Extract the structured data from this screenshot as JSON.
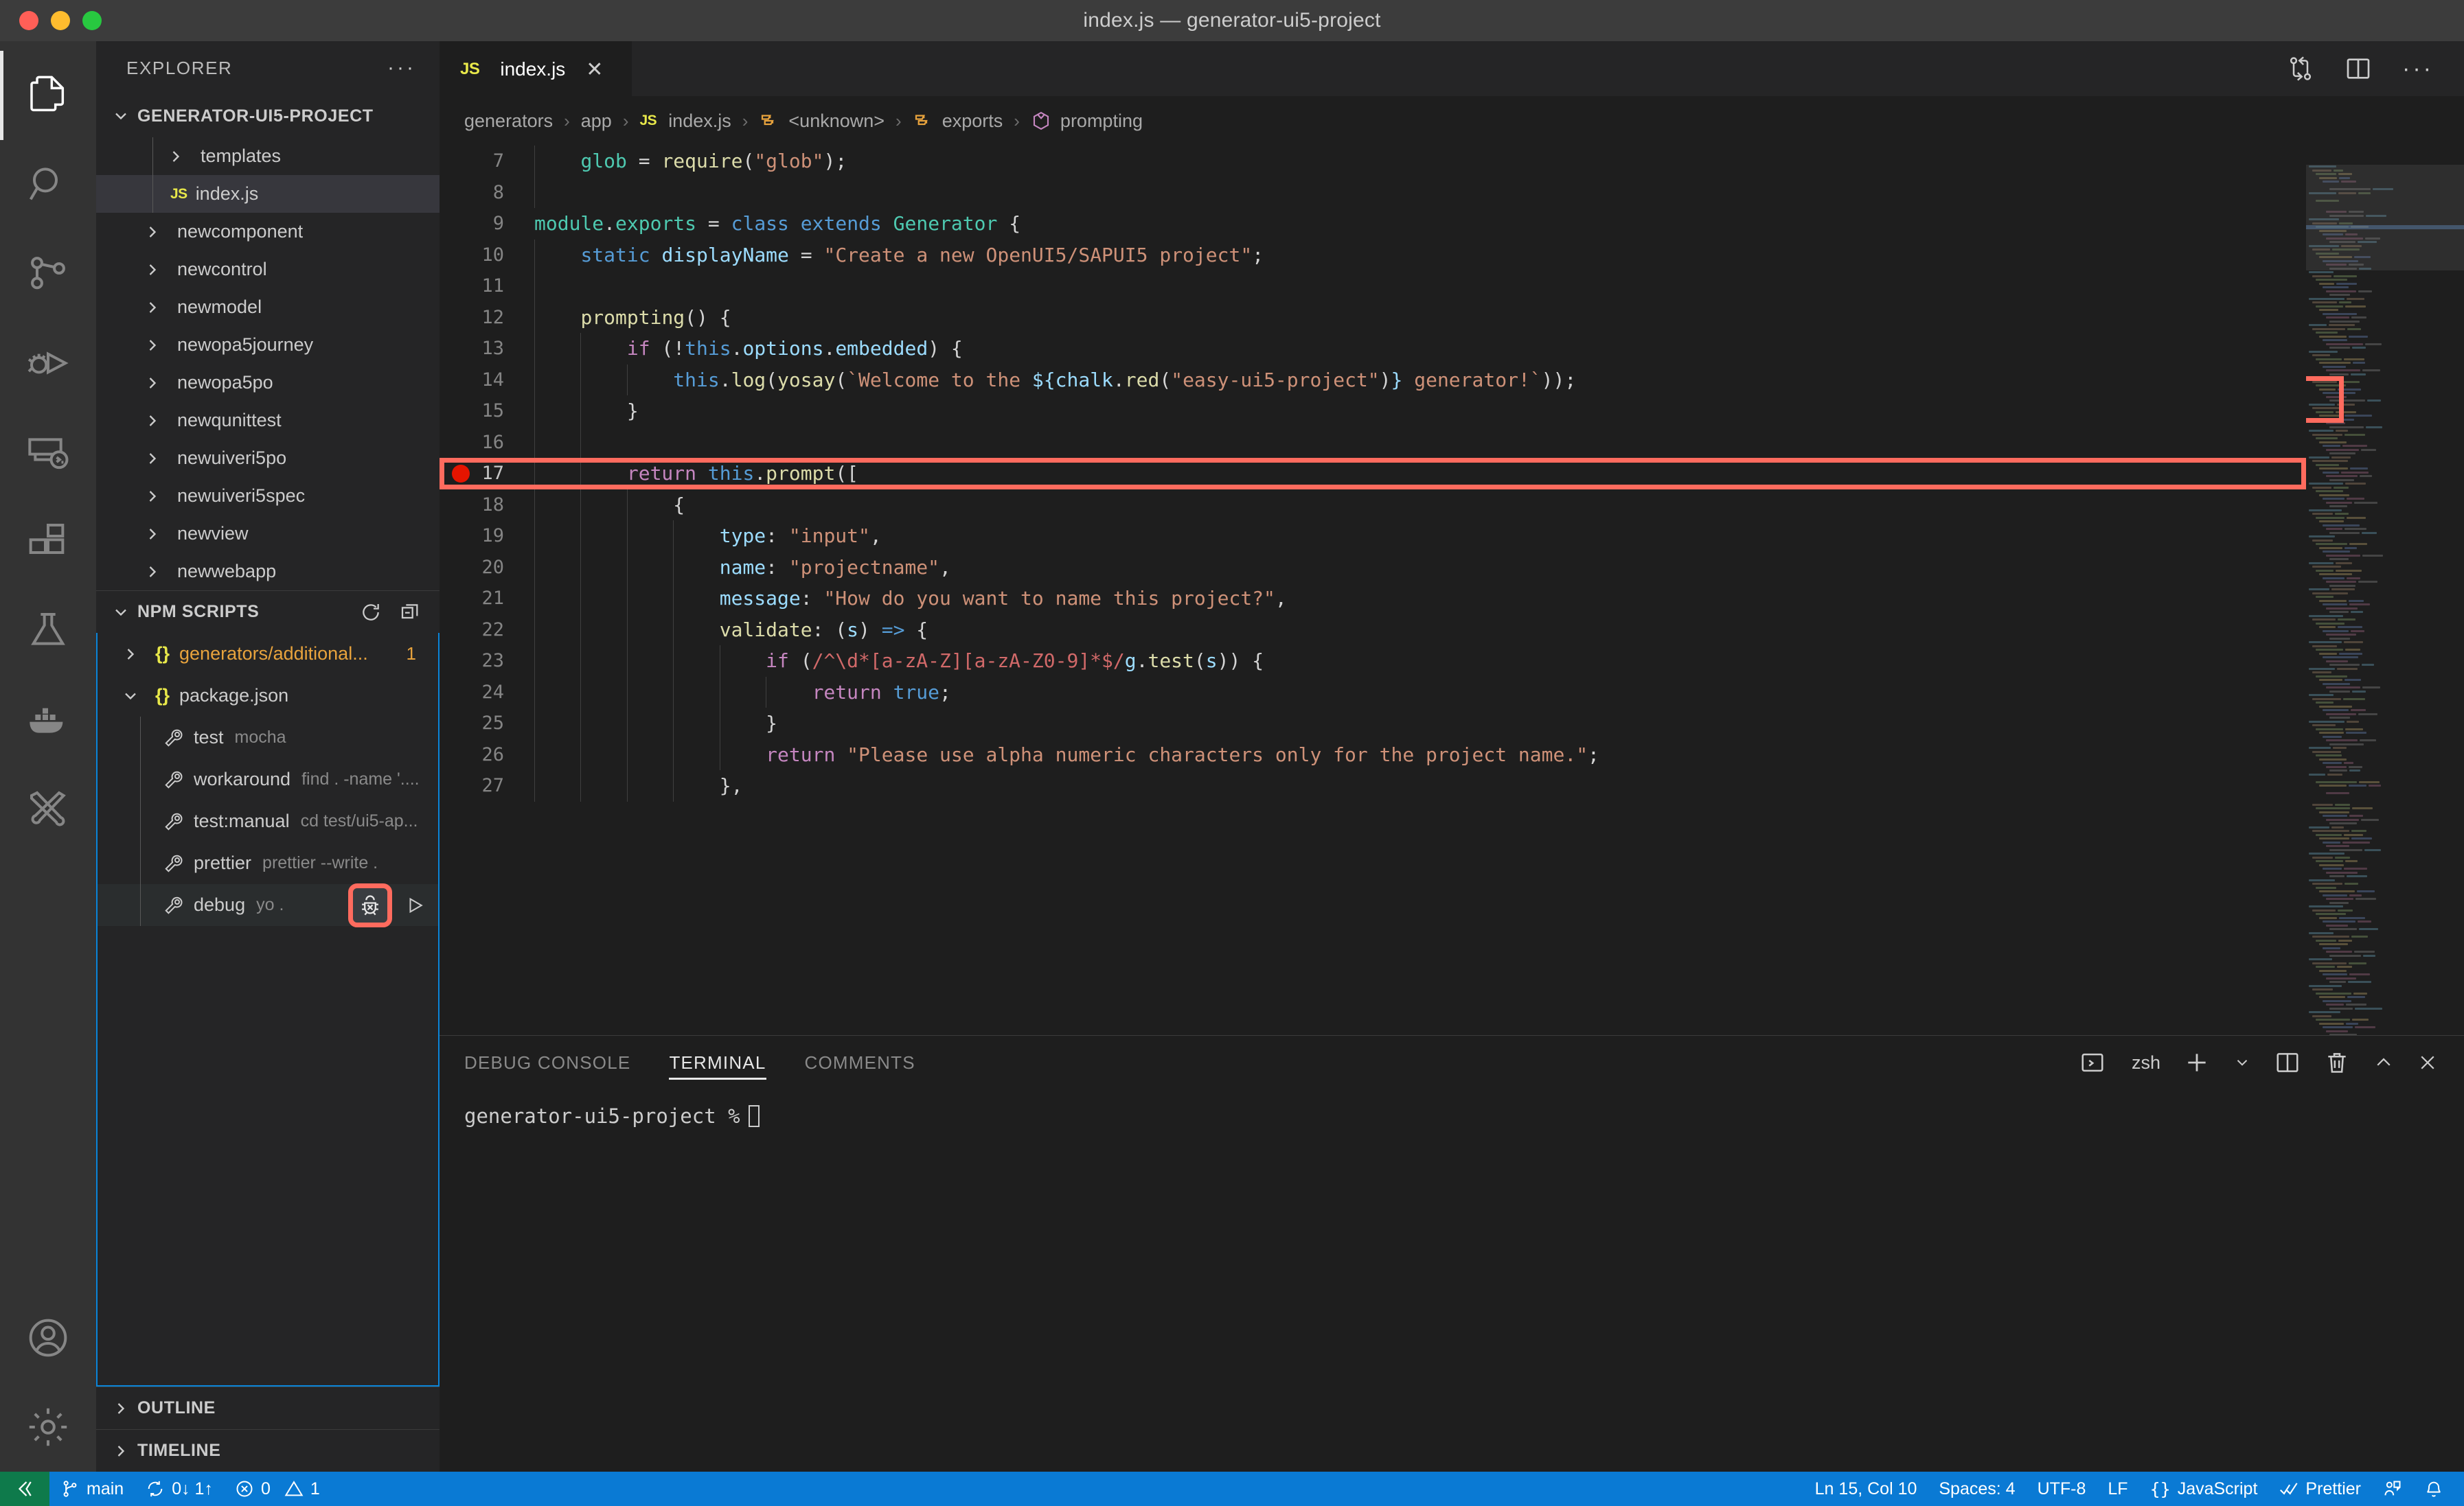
{
  "window": {
    "title": "index.js — generator-ui5-project",
    "traffic_lights": [
      "close-red",
      "minimize-yellow",
      "zoom-green"
    ]
  },
  "activitybar": {
    "items": [
      {
        "name": "explorer",
        "icon": "files-icon",
        "active": true
      },
      {
        "name": "search",
        "icon": "search-icon",
        "active": false
      },
      {
        "name": "source-control",
        "icon": "source-control-icon",
        "active": false
      },
      {
        "name": "run-and-debug",
        "icon": "run-debug-icon",
        "active": false
      },
      {
        "name": "remote-explorer",
        "icon": "remote-explorer-icon",
        "active": false
      },
      {
        "name": "extensions",
        "icon": "extensions-icon",
        "active": false
      },
      {
        "name": "testing",
        "icon": "beaker-icon",
        "active": false
      },
      {
        "name": "docker",
        "icon": "docker-whale-icon",
        "active": false
      },
      {
        "name": "tools",
        "icon": "tools-icon",
        "active": false
      }
    ],
    "bottom_items": [
      {
        "name": "accounts",
        "icon": "account-icon"
      },
      {
        "name": "manage",
        "icon": "gear-icon"
      }
    ]
  },
  "sidebar": {
    "header": "EXPLORER",
    "more_actions": "···",
    "explorer": {
      "root_label": "GENERATOR-UI5-PROJECT",
      "items": [
        {
          "label": "templates",
          "kind": "folder",
          "indent": 2,
          "expanded": false,
          "selected": false
        },
        {
          "label": "index.js",
          "kind": "js-file",
          "indent": 2,
          "expanded": false,
          "selected": true
        },
        {
          "label": "newcomponent",
          "kind": "folder",
          "indent": 1,
          "expanded": false,
          "selected": false
        },
        {
          "label": "newcontrol",
          "kind": "folder",
          "indent": 1,
          "expanded": false,
          "selected": false
        },
        {
          "label": "newmodel",
          "kind": "folder",
          "indent": 1,
          "expanded": false,
          "selected": false
        },
        {
          "label": "newopa5journey",
          "kind": "folder",
          "indent": 1,
          "expanded": false,
          "selected": false
        },
        {
          "label": "newopa5po",
          "kind": "folder",
          "indent": 1,
          "expanded": false,
          "selected": false
        },
        {
          "label": "newqunittest",
          "kind": "folder",
          "indent": 1,
          "expanded": false,
          "selected": false
        },
        {
          "label": "newuiveri5po",
          "kind": "folder",
          "indent": 1,
          "expanded": false,
          "selected": false
        },
        {
          "label": "newuiveri5spec",
          "kind": "folder",
          "indent": 1,
          "expanded": false,
          "selected": false
        },
        {
          "label": "newview",
          "kind": "folder",
          "indent": 1,
          "expanded": false,
          "selected": false
        },
        {
          "label": "newwebapp",
          "kind": "folder",
          "indent": 1,
          "expanded": false,
          "selected": false
        }
      ]
    },
    "npm_scripts": {
      "header": "NPM SCRIPTS",
      "actions": [
        {
          "name": "refresh-icon"
        },
        {
          "name": "collapse-all-icon"
        }
      ],
      "rows": [
        {
          "kind": "json-group",
          "label": "generators/additional...",
          "expanded": false,
          "count": "1",
          "highlight": true
        },
        {
          "kind": "json-group",
          "label": "package.json",
          "expanded": true,
          "count": "",
          "highlight": false
        },
        {
          "kind": "script",
          "label": "test",
          "cmd": "mocha"
        },
        {
          "kind": "script",
          "label": "workaround",
          "cmd": "find . -name '...."
        },
        {
          "kind": "script",
          "label": "test:manual",
          "cmd": "cd test/ui5-ap..."
        },
        {
          "kind": "script",
          "label": "prettier",
          "cmd": "prettier --write ."
        },
        {
          "kind": "script",
          "label": "debug",
          "cmd": "yo .",
          "hovered": true,
          "actions": [
            "debug-icon",
            "run-icon"
          ]
        }
      ]
    },
    "collapsed_sections": [
      "OUTLINE",
      "TIMELINE"
    ]
  },
  "editor": {
    "tab": {
      "label": "index.js",
      "icon": "js-icon",
      "close": "✕"
    },
    "tab_actions": [
      {
        "name": "split-changes-icon"
      },
      {
        "name": "split-editor-icon"
      },
      {
        "name": "more-actions-icon",
        "label": "···"
      }
    ],
    "breadcrumbs": [
      {
        "label": "generators",
        "icon": ""
      },
      {
        "label": "app",
        "icon": ""
      },
      {
        "label": "index.js",
        "icon": "js-icon"
      },
      {
        "label": "<unknown>",
        "icon": "symbol-field-icon"
      },
      {
        "label": "exports",
        "icon": "symbol-field-icon"
      },
      {
        "label": "prompting",
        "icon": "symbol-method-icon"
      }
    ],
    "separator": "›",
    "first_line_number": 7,
    "highlighted_line": 17,
    "breakpoint_line": 17,
    "lines": [
      {
        "n": 7,
        "indents": 1,
        "tokens": [
          [
            "    ",
            "plain"
          ],
          [
            "glob",
            "var"
          ],
          [
            " = ",
            "op"
          ],
          [
            "require",
            "fn"
          ],
          [
            "(",
            "plain"
          ],
          [
            "\"glob\"",
            "str"
          ],
          [
            ");",
            "plain"
          ]
        ]
      },
      {
        "n": 8,
        "indents": 1,
        "tokens": []
      },
      {
        "n": 9,
        "indents": 0,
        "tokens": [
          [
            "module",
            "var"
          ],
          [
            ".",
            "plain"
          ],
          [
            "exports",
            "var"
          ],
          [
            " = ",
            "op"
          ],
          [
            "class",
            "kw"
          ],
          [
            " ",
            "plain"
          ],
          [
            "extends",
            "kw"
          ],
          [
            " ",
            "plain"
          ],
          [
            "Generator",
            "cls"
          ],
          [
            " {",
            "plain"
          ]
        ]
      },
      {
        "n": 10,
        "indents": 1,
        "tokens": [
          [
            "    ",
            "plain"
          ],
          [
            "static",
            "kw"
          ],
          [
            " ",
            "plain"
          ],
          [
            "displayName",
            "prop"
          ],
          [
            " = ",
            "op"
          ],
          [
            "\"Create a new OpenUI5/SAPUI5 project\"",
            "str"
          ],
          [
            ";",
            "plain"
          ]
        ]
      },
      {
        "n": 11,
        "indents": 1,
        "tokens": []
      },
      {
        "n": 12,
        "indents": 1,
        "tokens": [
          [
            "    ",
            "plain"
          ],
          [
            "prompting",
            "fn"
          ],
          [
            "() {",
            "plain"
          ]
        ]
      },
      {
        "n": 13,
        "indents": 2,
        "tokens": [
          [
            "        ",
            "plain"
          ],
          [
            "if",
            "ctrl"
          ],
          [
            " (!",
            "plain"
          ],
          [
            "this",
            "kw"
          ],
          [
            ".",
            "plain"
          ],
          [
            "options",
            "prop"
          ],
          [
            ".",
            "plain"
          ],
          [
            "embedded",
            "prop"
          ],
          [
            ") {",
            "plain"
          ]
        ]
      },
      {
        "n": 14,
        "indents": 3,
        "tokens": [
          [
            "            ",
            "plain"
          ],
          [
            "this",
            "kw"
          ],
          [
            ".",
            "plain"
          ],
          [
            "log",
            "fn"
          ],
          [
            "(",
            "plain"
          ],
          [
            "yosay",
            "fn"
          ],
          [
            "(",
            "plain"
          ],
          [
            "`Welcome to the ",
            "str"
          ],
          [
            "${",
            "kw2"
          ],
          [
            "chalk",
            "prop"
          ],
          [
            ".",
            "plain"
          ],
          [
            "red",
            "fn"
          ],
          [
            "(",
            "plain"
          ],
          [
            "\"easy-ui5-project\"",
            "str"
          ],
          [
            ")",
            "plain"
          ],
          [
            "}",
            "kw2"
          ],
          [
            " generator!`",
            "str"
          ],
          [
            "));",
            "plain"
          ]
        ]
      },
      {
        "n": 15,
        "indents": 2,
        "tokens": [
          [
            "        }",
            "plain"
          ]
        ]
      },
      {
        "n": 16,
        "indents": 2,
        "tokens": []
      },
      {
        "n": 17,
        "indents": 2,
        "tokens": [
          [
            "        ",
            "plain"
          ],
          [
            "return",
            "ctrl"
          ],
          [
            " ",
            "plain"
          ],
          [
            "this",
            "kw"
          ],
          [
            ".",
            "plain"
          ],
          [
            "prompt",
            "fn"
          ],
          [
            "([",
            "plain"
          ]
        ]
      },
      {
        "n": 18,
        "indents": 3,
        "tokens": [
          [
            "            {",
            "plain"
          ]
        ]
      },
      {
        "n": 19,
        "indents": 4,
        "tokens": [
          [
            "                ",
            "plain"
          ],
          [
            "type",
            "prop"
          ],
          [
            ": ",
            "plain"
          ],
          [
            "\"input\"",
            "str"
          ],
          [
            ",",
            "plain"
          ]
        ]
      },
      {
        "n": 20,
        "indents": 4,
        "tokens": [
          [
            "                ",
            "plain"
          ],
          [
            "name",
            "prop"
          ],
          [
            ": ",
            "plain"
          ],
          [
            "\"projectname\"",
            "str"
          ],
          [
            ",",
            "plain"
          ]
        ]
      },
      {
        "n": 21,
        "indents": 4,
        "tokens": [
          [
            "                ",
            "plain"
          ],
          [
            "message",
            "prop"
          ],
          [
            ": ",
            "plain"
          ],
          [
            "\"How do you want to name this project?\"",
            "str"
          ],
          [
            ",",
            "plain"
          ]
        ]
      },
      {
        "n": 22,
        "indents": 4,
        "tokens": [
          [
            "                ",
            "plain"
          ],
          [
            "validate",
            "fn"
          ],
          [
            ": (",
            "plain"
          ],
          [
            "s",
            "prop"
          ],
          [
            ") ",
            "plain"
          ],
          [
            "=>",
            "kw"
          ],
          [
            " {",
            "plain"
          ]
        ]
      },
      {
        "n": 23,
        "indents": 5,
        "tokens": [
          [
            "                    ",
            "plain"
          ],
          [
            "if",
            "ctrl"
          ],
          [
            " (",
            "plain"
          ],
          [
            "/^\\d*[a-zA-Z][a-zA-Z0-9]*$/",
            "regex"
          ],
          [
            "g",
            "prop"
          ],
          [
            ".",
            "plain"
          ],
          [
            "test",
            "fn"
          ],
          [
            "(",
            "plain"
          ],
          [
            "s",
            "prop"
          ],
          [
            ")) {",
            "plain"
          ]
        ]
      },
      {
        "n": 24,
        "indents": 6,
        "tokens": [
          [
            "                        ",
            "plain"
          ],
          [
            "return",
            "ctrl"
          ],
          [
            " ",
            "plain"
          ],
          [
            "true",
            "kw"
          ],
          [
            ";",
            "plain"
          ]
        ]
      },
      {
        "n": 25,
        "indents": 5,
        "tokens": [
          [
            "                    }",
            "plain"
          ]
        ]
      },
      {
        "n": 26,
        "indents": 5,
        "tokens": [
          [
            "                    ",
            "plain"
          ],
          [
            "return",
            "ctrl"
          ],
          [
            " ",
            "plain"
          ],
          [
            "\"Please use alpha numeric characters only for the project name.\"",
            "str"
          ],
          [
            ";",
            "plain"
          ]
        ]
      },
      {
        "n": 27,
        "indents": 4,
        "tokens": [
          [
            "                },",
            "plain"
          ]
        ]
      }
    ]
  },
  "panel": {
    "tabs": [
      {
        "label": "DEBUG CONSOLE",
        "active": false
      },
      {
        "label": "TERMINAL",
        "active": true
      },
      {
        "label": "COMMENTS",
        "active": false
      }
    ],
    "shell_label": "zsh",
    "actions": [
      {
        "name": "terminal-icon"
      },
      {
        "name": "new-terminal-icon",
        "label": "+"
      },
      {
        "name": "terminal-dropdown-icon",
        "label": "⌄"
      },
      {
        "name": "split-terminal-icon"
      },
      {
        "name": "kill-terminal-icon"
      },
      {
        "name": "maximize-panel-icon",
        "label": "^"
      },
      {
        "name": "close-panel-icon",
        "label": "✕"
      }
    ],
    "terminal_prompt": "generator-ui5-project %"
  },
  "statusbar": {
    "remote_icon": "remote-host-icon",
    "left": [
      {
        "name": "branch",
        "icon": "git-branch-icon",
        "label": "main"
      },
      {
        "name": "sync",
        "icon": "sync-icon",
        "label": "0↓ 1↑"
      },
      {
        "name": "problems",
        "icon": "error-warning-icon",
        "label": "0",
        "label2": "1"
      }
    ],
    "right": [
      {
        "name": "cursor-position",
        "label": "Ln 15, Col 10"
      },
      {
        "name": "indentation",
        "label": "Spaces: 4"
      },
      {
        "name": "encoding",
        "label": "UTF-8"
      },
      {
        "name": "eol",
        "label": "LF"
      },
      {
        "name": "language-mode",
        "label": "JavaScript",
        "icon": "braces-icon"
      },
      {
        "name": "prettier",
        "label": "Prettier",
        "icon": "check-check-icon"
      },
      {
        "name": "live-share",
        "icon": "live-share-icon"
      },
      {
        "name": "notifications",
        "icon": "bell-icon"
      }
    ]
  },
  "colors": {
    "accent_blue": "#0a7ad4",
    "remote_green": "#0e7a4b",
    "highlight_red": "#ff6b5e",
    "breakpoint_red": "#e51400",
    "editor_bg": "#1e1e1e",
    "sidebar_bg": "#252526",
    "activitybar_bg": "#333333",
    "titlebar_bg": "#3c3c3c"
  }
}
